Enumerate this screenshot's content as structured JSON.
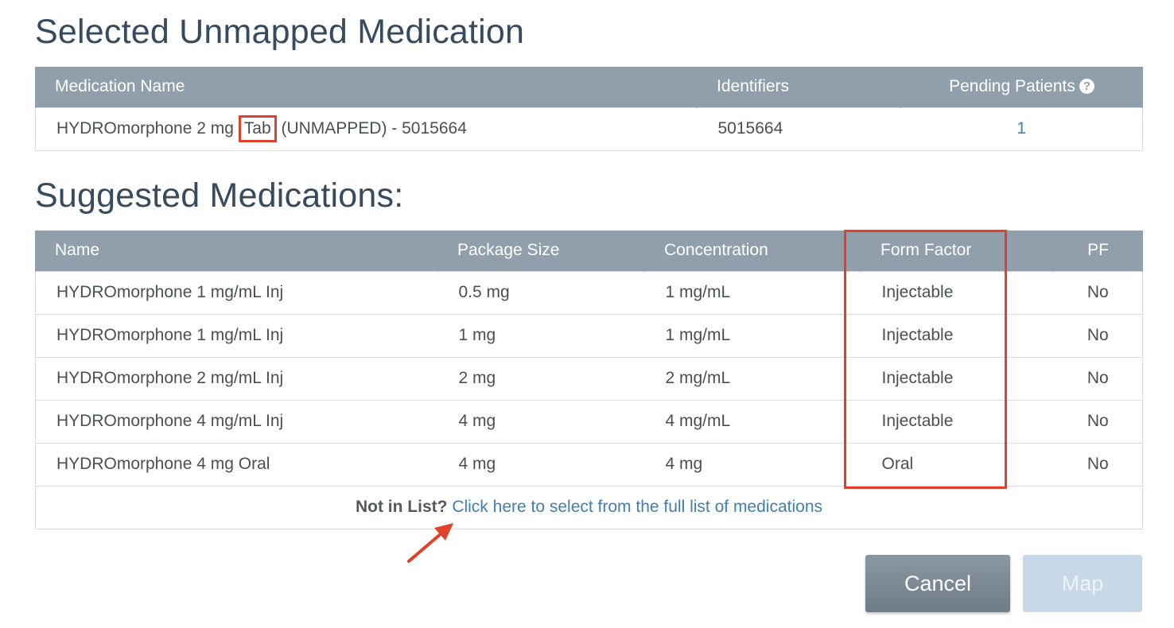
{
  "unmapped": {
    "title": "Selected Unmapped Medication",
    "headers": {
      "name": "Medication Name",
      "identifiers": "Identifiers",
      "pending": "Pending Patients"
    },
    "help_icon": "question-circle-icon",
    "row": {
      "name_prefix": "HYDROmorphone 2 mg ",
      "name_highlight": "Tab",
      "name_suffix": " (UNMAPPED) - 5015664",
      "identifier": "5015664",
      "pending": "1"
    }
  },
  "suggested": {
    "title": "Suggested Medications:",
    "headers": {
      "name": "Name",
      "package": "Package Size",
      "concentration": "Concentration",
      "form": "Form Factor",
      "pf": "PF"
    },
    "rows": [
      {
        "name": "HYDROmorphone 1 mg/mL Inj",
        "package": "0.5 mg",
        "concentration": "1 mg/mL",
        "form": "Injectable",
        "pf": "No"
      },
      {
        "name": "HYDROmorphone 1 mg/mL Inj",
        "package": "1 mg",
        "concentration": "1 mg/mL",
        "form": "Injectable",
        "pf": "No"
      },
      {
        "name": "HYDROmorphone 2 mg/mL Inj",
        "package": "2 mg",
        "concentration": "2 mg/mL",
        "form": "Injectable",
        "pf": "No"
      },
      {
        "name": "HYDROmorphone 4 mg/mL Inj",
        "package": "4 mg",
        "concentration": "4 mg/mL",
        "form": "Injectable",
        "pf": "No"
      },
      {
        "name": "HYDROmorphone 4 mg Oral",
        "package": "4 mg",
        "concentration": "4 mg",
        "form": "Oral",
        "pf": "No"
      }
    ],
    "not_in_list_label": "Not in List?",
    "not_in_list_link": "Click here to select from the full list of medications"
  },
  "buttons": {
    "cancel": "Cancel",
    "map": "Map"
  },
  "colors": {
    "header_bg": "#909fab",
    "link": "#3f7fb3",
    "annotation": "#e0412b",
    "title": "#384a5e"
  }
}
